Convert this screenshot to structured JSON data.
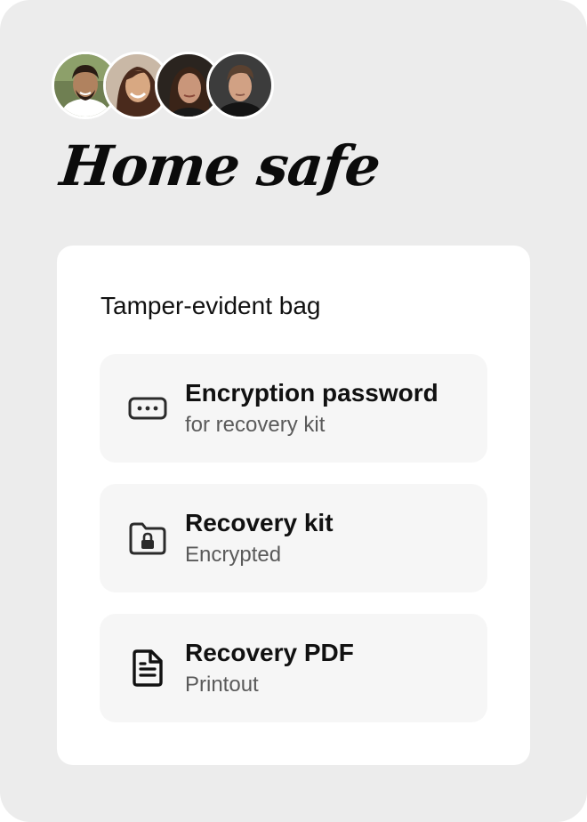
{
  "header": {
    "avatars": [
      {
        "name": "person-1",
        "skin": "#b0825f",
        "hair": "#2a1c14",
        "shirt": "#ffffff",
        "bg": "#6f7f52"
      },
      {
        "name": "person-2",
        "skin": "#d8a882",
        "hair": "#4a2a1c",
        "shirt": "#e9e2da",
        "bg": "#c9b8a6"
      },
      {
        "name": "person-3",
        "skin": "#c9967a",
        "hair": "#3a2418",
        "shirt": "#1a1a1a",
        "bg": "#2a241f"
      },
      {
        "name": "person-4",
        "skin": "#d1a184",
        "hair": "#5a4130",
        "shirt": "#141414",
        "bg": "#3c3c3c"
      }
    ],
    "title": "Home safe"
  },
  "card": {
    "heading": "Tamper-evident bag",
    "items": [
      {
        "icon": "password-icon",
        "label": "Encryption password",
        "sub": "for recovery kit"
      },
      {
        "icon": "locked-folder-icon",
        "label": "Recovery kit",
        "sub": "Encrypted"
      },
      {
        "icon": "document-icon",
        "label": "Recovery PDF",
        "sub": "Printout"
      }
    ]
  }
}
